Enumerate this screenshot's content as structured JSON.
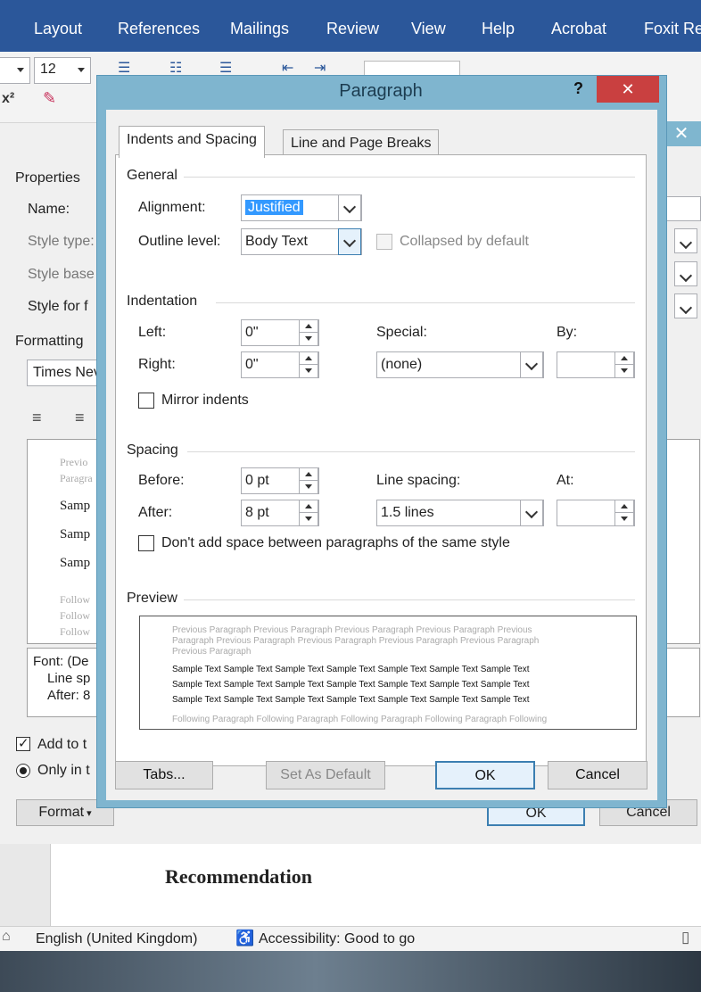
{
  "ribbon": {
    "tabs": [
      "Layout",
      "References",
      "Mailings",
      "Review",
      "View",
      "Help",
      "Acrobat",
      "Foxit Re"
    ],
    "font_size": "12",
    "superscript_icon": "x²"
  },
  "modify_style": {
    "properties_heading": "Properties",
    "name_label": "Name:",
    "style_type_label": "Style type:",
    "style_based_label": "Style base",
    "style_following_label": "Style for f",
    "formatting_heading": "Formatting",
    "font_value": "Times Nev",
    "preview_prev_1": "Previo",
    "preview_prev_2": "Paragra",
    "preview_samples": [
      "Samp",
      "Samp",
      "Samp"
    ],
    "preview_follow": [
      "Follow",
      "Follow",
      "Follow"
    ],
    "desc_lines": [
      "Font: (De",
      "Line sp",
      "After: 8"
    ],
    "add_to_label": "Add to t",
    "only_in_label": "Only in t",
    "format_button": "Format",
    "ok_button": "OK",
    "cancel_button": "Cancel"
  },
  "document": {
    "heading": "Recommendation"
  },
  "statusbar": {
    "language": "English (United Kingdom)",
    "accessibility": "Accessibility: Good to go"
  },
  "dialog": {
    "title": "Paragraph",
    "help": "?",
    "close": "✕",
    "tabs": {
      "indents_spacing": "Indents and Spacing",
      "line_page_breaks": "Line and Page Breaks"
    },
    "general": {
      "heading": "General",
      "alignment_label": "Alignment:",
      "alignment_value": "Justified",
      "outline_label": "Outline level:",
      "outline_value": "Body Text",
      "collapsed_label": "Collapsed by default"
    },
    "indentation": {
      "heading": "Indentation",
      "left_label": "Left:",
      "left_value": "0\"",
      "right_label": "Right:",
      "right_value": "0\"",
      "special_label": "Special:",
      "special_value": "(none)",
      "by_label": "By:",
      "by_value": "",
      "mirror_label": "Mirror indents"
    },
    "spacing": {
      "heading": "Spacing",
      "before_label": "Before:",
      "before_value": "0 pt",
      "after_label": "After:",
      "after_value": "8 pt",
      "line_spacing_label": "Line spacing:",
      "line_spacing_value": "1.5 lines",
      "at_label": "At:",
      "at_value": "",
      "dont_add_label": "Don't add space between paragraphs of the same style"
    },
    "preview": {
      "heading": "Preview",
      "previous_lines": [
        "Previous Paragraph Previous Paragraph Previous Paragraph Previous Paragraph Previous",
        "Paragraph Previous Paragraph Previous Paragraph Previous Paragraph Previous Paragraph",
        "Previous Paragraph"
      ],
      "sample_lines": [
        "Sample Text Sample Text Sample Text Sample Text Sample Text Sample Text Sample Text",
        "Sample Text Sample Text Sample Text Sample Text Sample Text Sample Text Sample Text",
        "Sample Text Sample Text Sample Text Sample Text Sample Text Sample Text Sample Text"
      ],
      "following_lines": [
        "Following Paragraph Following Paragraph Following Paragraph Following Paragraph Following"
      ]
    },
    "buttons": {
      "tabs": "Tabs...",
      "set_default": "Set As Default",
      "ok": "OK",
      "cancel": "Cancel"
    }
  },
  "colors": {
    "ribbon": "#2b579a",
    "dialog_frame": "#7fb5cf",
    "close_button": "#c94040",
    "selection": "#3399ff"
  }
}
